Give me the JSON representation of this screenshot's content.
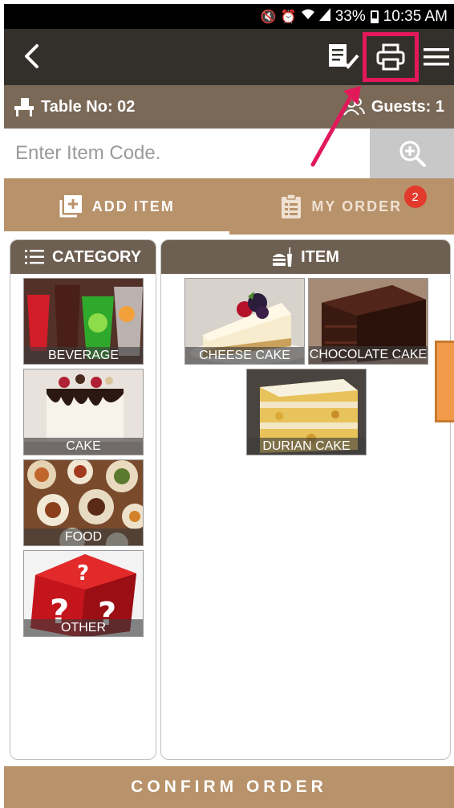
{
  "status_bar": {
    "battery": "33%",
    "time": "10:35 AM"
  },
  "table_bar": {
    "table_label": "Table No: 02",
    "guests_label": "Guests: 1"
  },
  "search": {
    "placeholder": "Enter Item Code."
  },
  "tabs": {
    "add_item": "ADD ITEM",
    "my_order": "MY ORDER",
    "order_count": "2"
  },
  "category_panel": {
    "title": "CATEGORY",
    "items": [
      {
        "label": "BEVERAGE"
      },
      {
        "label": "CAKE"
      },
      {
        "label": "FOOD"
      },
      {
        "label": "OTHER"
      }
    ]
  },
  "item_panel": {
    "title": "ITEM",
    "items": [
      {
        "label": "CHEESE CAKE"
      },
      {
        "label": "CHOCOLATE CAKE"
      },
      {
        "label": "DURIAN CAKE"
      }
    ]
  },
  "confirm_label": "CONFIRM ORDER",
  "colors": {
    "top_bar": "#33302c",
    "table_bar": "#7a6957",
    "tab_bar": "#b8926a",
    "panel_header": "#6d5f51",
    "highlight": "#e3185b",
    "badge": "#e33a2e",
    "side_handle": "#f29a4a"
  }
}
